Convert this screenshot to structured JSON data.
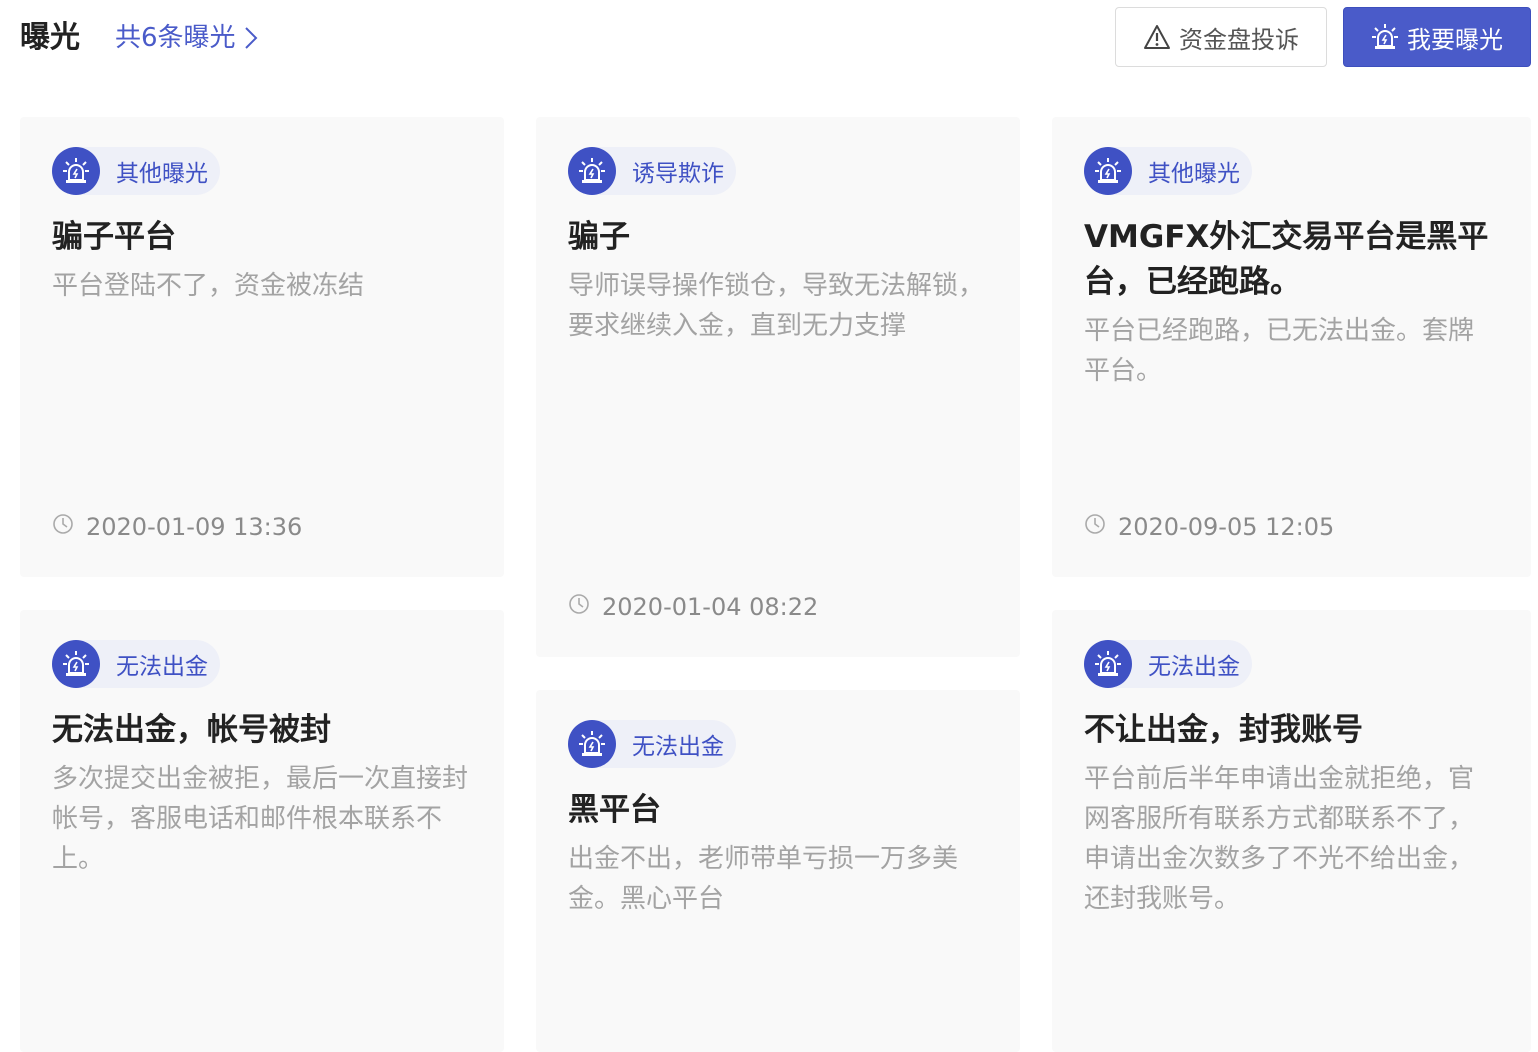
{
  "header": {
    "title": "曝光",
    "count_link": "共6条曝光",
    "complain_label": "资金盘投诉",
    "expose_label": "我要曝光"
  },
  "cards": [
    {
      "tag": "其他曝光",
      "title": "骗子平台",
      "desc": "平台登陆不了，资金被冻结",
      "time": "2020-01-09 13:36"
    },
    {
      "tag": "诱导欺诈",
      "title": "骗子",
      "desc": "导师误导操作锁仓，导致无法解锁，要求继续入金，直到无力支撑",
      "time": "2020-01-04 08:22"
    },
    {
      "tag": "其他曝光",
      "title": "VMGFX外汇交易平台是黑平台，已经跑路。",
      "desc": "平台已经跑路，已无法出金。套牌平台。",
      "time": "2020-09-05 12:05"
    },
    {
      "tag": "无法出金",
      "title": "无法出金，帐号被封",
      "desc": "多次提交出金被拒，最后一次直接封帐号，客服电话和邮件根本联系不上。",
      "time": ""
    },
    {
      "tag": "无法出金",
      "title": "黑平台",
      "desc": "出金不出，老师带单亏损一万多美金。黑心平台",
      "time": ""
    },
    {
      "tag": "无法出金",
      "title": "不让出金，封我账号",
      "desc": "平台前后半年申请出金就拒绝，官网客服所有联系方式都联系不了，申请出金次数多了不光不给出金，还封我账号。",
      "time": ""
    }
  ],
  "colors": {
    "accent": "#4a5bc9",
    "card_bg": "#f9f9f9",
    "tag_bg": "#eef0f8"
  },
  "icons": {
    "tag_badge": "alarm-icon",
    "time": "clock-icon",
    "complain": "warning-icon",
    "expose": "alarm-icon"
  }
}
